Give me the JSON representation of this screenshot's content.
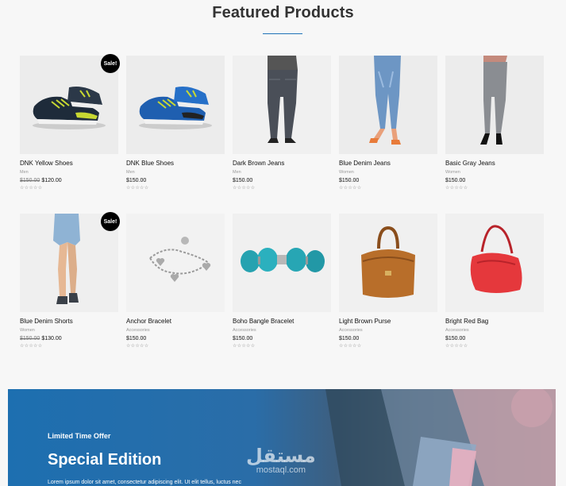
{
  "section": {
    "title": "Featured Products"
  },
  "sale_badge": "Sale!",
  "rating_stars": "☆☆☆☆☆",
  "products": [
    {
      "name": "DNK Yellow Shoes",
      "category": "Men",
      "old_price": "$150.00",
      "price": "$120.00",
      "sale": true,
      "icon": "sneaker-yellow"
    },
    {
      "name": "DNK Blue Shoes",
      "category": "Men",
      "old_price": "",
      "price": "$150.00",
      "sale": false,
      "icon": "sneaker-blue"
    },
    {
      "name": "Dark Brown Jeans",
      "category": "Men",
      "old_price": "",
      "price": "$150.00",
      "sale": false,
      "icon": "dark-jeans"
    },
    {
      "name": "Blue Denim Jeans",
      "category": "Women",
      "old_price": "",
      "price": "$150.00",
      "sale": false,
      "icon": "blue-jeans"
    },
    {
      "name": "Basic Gray Jeans",
      "category": "Women",
      "old_price": "",
      "price": "$150.00",
      "sale": false,
      "icon": "gray-jeans"
    },
    {
      "name": "Blue Denim Shorts",
      "category": "Women",
      "old_price": "$150.00",
      "price": "$130.00",
      "sale": true,
      "icon": "denim-shorts"
    },
    {
      "name": "Anchor Bracelet",
      "category": "Accessories",
      "old_price": "",
      "price": "$150.00",
      "sale": false,
      "icon": "silver-bracelet"
    },
    {
      "name": "Boho Bangle Bracelet",
      "category": "Accessories",
      "old_price": "",
      "price": "$150.00",
      "sale": false,
      "icon": "turquoise-bracelet"
    },
    {
      "name": "Light Brown Purse",
      "category": "Accessories",
      "old_price": "",
      "price": "$150.00",
      "sale": false,
      "icon": "brown-purse"
    },
    {
      "name": "Bright Red Bag",
      "category": "Accessories",
      "old_price": "",
      "price": "$150.00",
      "sale": false,
      "icon": "red-bag"
    }
  ],
  "banner": {
    "eyebrow": "Limited Time Offer",
    "title": "Special Edition",
    "text": "Lorem ipsum dolor sit amet, consectetur adipiscing elit. Ut elit tellus, luctus nec"
  },
  "watermark": {
    "arabic": "مستقل",
    "latin": "mostaql.com"
  },
  "colors": {
    "accent": "#1f73b7",
    "sale_badge": "#000000",
    "text": "#111111"
  }
}
